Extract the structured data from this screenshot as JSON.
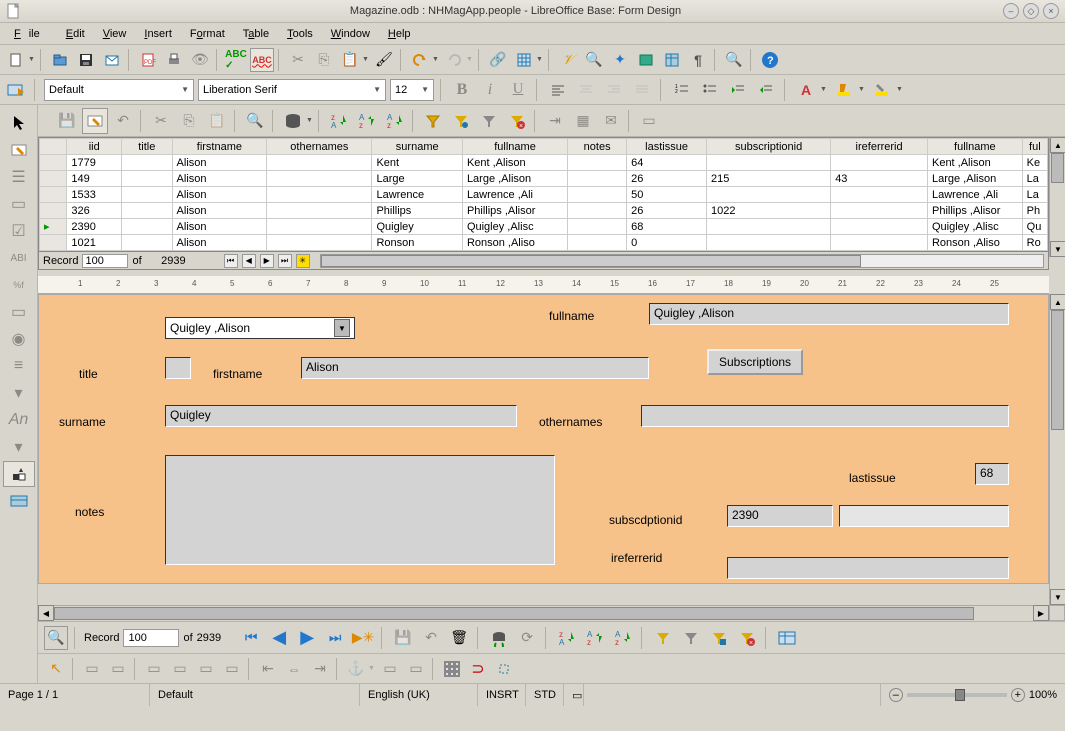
{
  "window": {
    "title": "Magazine.odb : NHMagApp.people - LibreOffice Base: Form Design"
  },
  "menu": {
    "items": [
      "File",
      "Edit",
      "View",
      "Insert",
      "Format",
      "Table",
      "Tools",
      "Window",
      "Help"
    ]
  },
  "format": {
    "para_style": "Default",
    "font": "Liberation Serif",
    "size": "12"
  },
  "table": {
    "columns": [
      "iid",
      "title",
      "firstname",
      "othernames",
      "surname",
      "fullname",
      "notes",
      "lastissue",
      "subscriptionid",
      "ireferrerid",
      "fullname",
      "ful"
    ],
    "rows": [
      {
        "cells": [
          "1779",
          "",
          "Alison",
          "",
          "Kent",
          "Kent ,Alison",
          "",
          "64",
          "",
          "",
          "Kent ,Alison",
          "Ke"
        ]
      },
      {
        "cells": [
          "149",
          "",
          "Alison",
          "",
          "Large",
          "Large ,Alison",
          "",
          "26",
          "215",
          "43",
          "Large ,Alison",
          "La"
        ]
      },
      {
        "cells": [
          "1533",
          "",
          "Alison",
          "",
          "Lawrence",
          "Lawrence ,Ali",
          "",
          "50",
          "",
          "",
          "Lawrence ,Ali",
          "La"
        ]
      },
      {
        "cells": [
          "326",
          "",
          "Alison",
          "",
          "Phillips",
          "Phillips ,Alisor",
          "",
          "26",
          "1022",
          "",
          "Phillips ,Alisor",
          "Ph"
        ]
      },
      {
        "cells": [
          "2390",
          "",
          "Alison",
          "",
          "Quigley",
          "Quigley ,Alisc",
          "",
          "68",
          "",
          "",
          "Quigley ,Alisc",
          "Qu"
        ]
      },
      {
        "cells": [
          "1021",
          "",
          "Alison",
          "",
          "Ronson",
          "Ronson ,Aliso",
          "",
          "0",
          "",
          "",
          "Ronson ,Aliso",
          "Ro"
        ]
      }
    ],
    "record_index": "100",
    "record_total": "2939"
  },
  "form": {
    "combo_value": "Quigley ,Alison",
    "labels": {
      "fullname": "fullname",
      "title": "title",
      "firstname": "firstname",
      "surname": "surname",
      "othernames": "othernames",
      "notes": "notes",
      "subscriptionid": "subscdptionid",
      "ireferrerid": "ireferrerid",
      "lastissue": "lastissue"
    },
    "values": {
      "fullname": "Quigley ,Alison",
      "title": "",
      "firstname": "Alison",
      "surname": "Quigley",
      "othernames": "",
      "notes": "",
      "subscriptionid": "2390",
      "ireferrerid": "",
      "lastissue": "68"
    },
    "button_subscriptions": "Subscriptions"
  },
  "nav": {
    "record_label": "Record",
    "record_index": "100",
    "of": "of",
    "record_total": "2939"
  },
  "status": {
    "page": "Page 1 / 1",
    "style": "Default",
    "lang": "English (UK)",
    "insert": "INSRT",
    "sel": "STD",
    "zoom": "100%"
  },
  "record_label": "Record",
  "of_label": "of"
}
